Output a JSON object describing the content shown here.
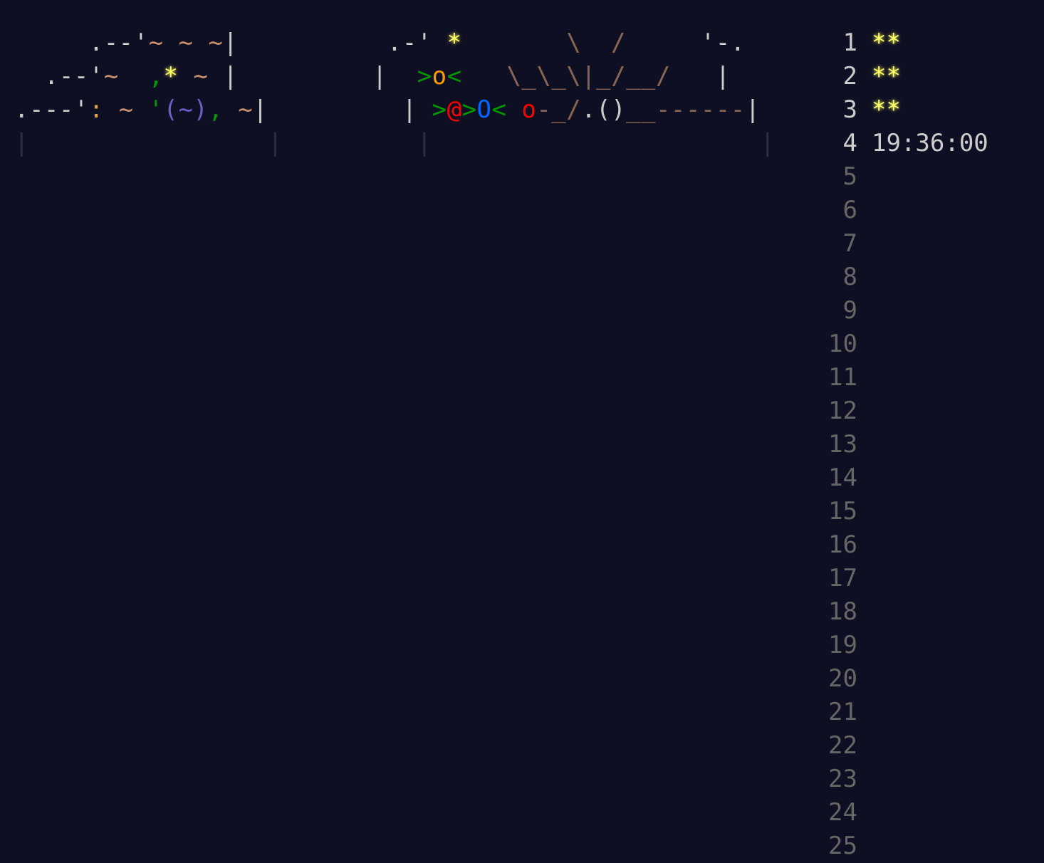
{
  "calendar": {
    "rows": [
      {
        "segments": [
          {
            "t": "     .--'",
            "c": "c-border"
          },
          {
            "t": "~ ~ ~",
            "c": "c-tilde"
          },
          {
            "t": "|",
            "c": "c-border"
          },
          {
            "t": "          ",
            "c": "c-border"
          },
          {
            "t": ".-' ",
            "c": "c-border"
          },
          {
            "t": "*",
            "c": "c-star"
          },
          {
            "t": "       ",
            "c": "c-border"
          },
          {
            "t": "\\  /",
            "c": "c-brown"
          },
          {
            "t": "     '-.",
            "c": "c-border"
          }
        ]
      },
      {
        "segments": [
          {
            "t": "  .--'",
            "c": "c-border"
          },
          {
            "t": "~  ",
            "c": "c-tilde"
          },
          {
            "t": ",",
            "c": "c-green"
          },
          {
            "t": "*",
            "c": "c-star"
          },
          {
            "t": " ",
            "c": "c-border"
          },
          {
            "t": "~",
            "c": "c-tilde"
          },
          {
            "t": " |",
            "c": "c-border"
          },
          {
            "t": "         ",
            "c": "c-border"
          },
          {
            "t": "|  ",
            "c": "c-border"
          },
          {
            "t": ">",
            "c": "c-green"
          },
          {
            "t": "o",
            "c": "c-orange"
          },
          {
            "t": "<",
            "c": "c-green"
          },
          {
            "t": "   ",
            "c": "c-border"
          },
          {
            "t": "\\_\\_\\|_/__/",
            "c": "c-brown"
          },
          {
            "t": "   |",
            "c": "c-border"
          }
        ]
      },
      {
        "segments": [
          {
            "t": ".---'",
            "c": "c-border"
          },
          {
            "t": ":",
            "c": "c-colon"
          },
          {
            "t": " ",
            "c": "c-border"
          },
          {
            "t": "~",
            "c": "c-tilde"
          },
          {
            "t": " ",
            "c": "c-border"
          },
          {
            "t": "'",
            "c": "c-green"
          },
          {
            "t": "(~)",
            "c": "c-purple"
          },
          {
            "t": ",",
            "c": "c-green"
          },
          {
            "t": " ",
            "c": "c-border"
          },
          {
            "t": "~",
            "c": "c-tilde"
          },
          {
            "t": "|",
            "c": "c-border"
          },
          {
            "t": "         ",
            "c": "c-border"
          },
          {
            "t": "| ",
            "c": "c-border"
          },
          {
            "t": ">",
            "c": "c-green"
          },
          {
            "t": "@",
            "c": "c-red"
          },
          {
            "t": ">",
            "c": "c-green"
          },
          {
            "t": "O",
            "c": "c-blue"
          },
          {
            "t": "<",
            "c": "c-green"
          },
          {
            "t": " ",
            "c": "c-border"
          },
          {
            "t": "o",
            "c": "c-red"
          },
          {
            "t": "-_/",
            "c": "c-brown"
          },
          {
            "t": ".()",
            "c": "c-border"
          },
          {
            "t": "__------",
            "c": "c-brown"
          },
          {
            "t": "|",
            "c": "c-border"
          }
        ]
      },
      {
        "segments": [
          {
            "t": "|                ",
            "c": "c-dim"
          },
          {
            "t": "|",
            "c": "c-dim"
          },
          {
            "t": "         ",
            "c": "c-dim"
          },
          {
            "t": "|                      ",
            "c": "c-dim"
          },
          {
            "t": "|",
            "c": "c-dim"
          }
        ]
      }
    ]
  },
  "days": [
    {
      "num": "1",
      "stars": "**",
      "done": true
    },
    {
      "num": "2",
      "stars": "**",
      "done": true
    },
    {
      "num": "3",
      "stars": "**",
      "done": true
    },
    {
      "num": "4",
      "info": "19:36:00",
      "done": false
    },
    {
      "num": "5"
    },
    {
      "num": "6"
    },
    {
      "num": "7"
    },
    {
      "num": "8"
    },
    {
      "num": "9"
    },
    {
      "num": "10"
    },
    {
      "num": "11"
    },
    {
      "num": "12"
    },
    {
      "num": "13"
    },
    {
      "num": "14"
    },
    {
      "num": "15"
    },
    {
      "num": "16"
    },
    {
      "num": "17"
    },
    {
      "num": "18"
    },
    {
      "num": "19"
    },
    {
      "num": "20"
    },
    {
      "num": "21"
    },
    {
      "num": "22"
    },
    {
      "num": "23"
    },
    {
      "num": "24"
    },
    {
      "num": "25"
    }
  ],
  "colors": {
    "background": "#0f0f23",
    "text": "#cccccc",
    "muted": "#666666",
    "star": "#ffff66",
    "green": "#009900",
    "red": "#ff0000",
    "blue": "#0066ff",
    "orange": "#ff9900",
    "purple": "#6b5fc9",
    "brown": "#886655"
  }
}
